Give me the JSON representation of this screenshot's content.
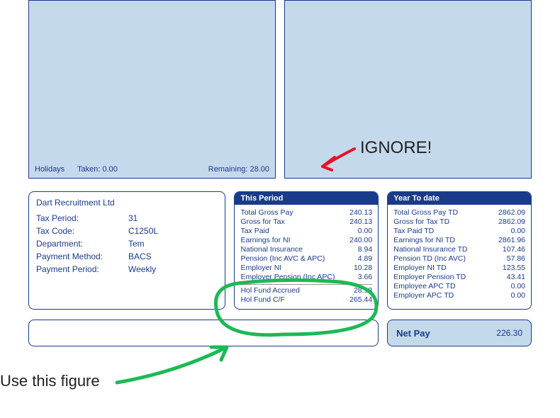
{
  "holidays": {
    "label": "Holidays",
    "taken_label": "Taken:",
    "taken_value": "0.00",
    "remaining_label": "Remaining:",
    "remaining_value": "28.00"
  },
  "info": {
    "company": "Dart Recruitment Ltd",
    "rows": [
      {
        "label": "Tax Period:",
        "value": "31"
      },
      {
        "label": "Tax Code:",
        "value": "C1250L"
      },
      {
        "label": "Department:",
        "value": "Tem"
      },
      {
        "label": "Payment Method:",
        "value": "BACS"
      },
      {
        "label": "Payment Period:",
        "value": "Weekly"
      }
    ]
  },
  "this_period": {
    "header": "This Period",
    "lines": [
      {
        "label": "Total Gross Pay",
        "value": "240.13"
      },
      {
        "label": "Gross for Tax",
        "value": "240.13"
      },
      {
        "label": "Tax Paid",
        "value": "0.00"
      },
      {
        "label": "Earnings for NI",
        "value": "240.00"
      },
      {
        "label": "National Insurance",
        "value": "8.94"
      },
      {
        "label": "Pension (Inc AVC & APC)",
        "value": "4.89"
      },
      {
        "label": "Employer NI",
        "value": "10.28"
      },
      {
        "label": "Employer Pension (Inc APC)",
        "value": "3.66"
      }
    ],
    "extras": [
      {
        "label": "Hol Fund Accrued",
        "value": "28.98"
      },
      {
        "label": "Hol Fund C/F",
        "value": "265.44"
      }
    ]
  },
  "year_to_date": {
    "header": "Year To date",
    "lines": [
      {
        "label": "Total Gross Pay TD",
        "value": "2862.09"
      },
      {
        "label": "Gross for Tax TD",
        "value": "2862.09"
      },
      {
        "label": "Tax Paid TD",
        "value": "0.00"
      },
      {
        "label": "Earnings for NI TD",
        "value": "2861.96"
      },
      {
        "label": "National Insurance TD",
        "value": "107.46"
      },
      {
        "label": "Pension TD (Inc AVC)",
        "value": "57.86"
      },
      {
        "label": "Employer NI TD",
        "value": "123.55"
      },
      {
        "label": "Employer Pension TD",
        "value": "43.41"
      },
      {
        "label": "Employee APC TD",
        "value": "0.00"
      },
      {
        "label": "Employer APC TD",
        "value": "0.00"
      }
    ]
  },
  "net_pay": {
    "label": "Net Pay",
    "value": "226.30"
  },
  "annotations": {
    "ignore": "IGNORE!",
    "use": "Use this figure"
  }
}
